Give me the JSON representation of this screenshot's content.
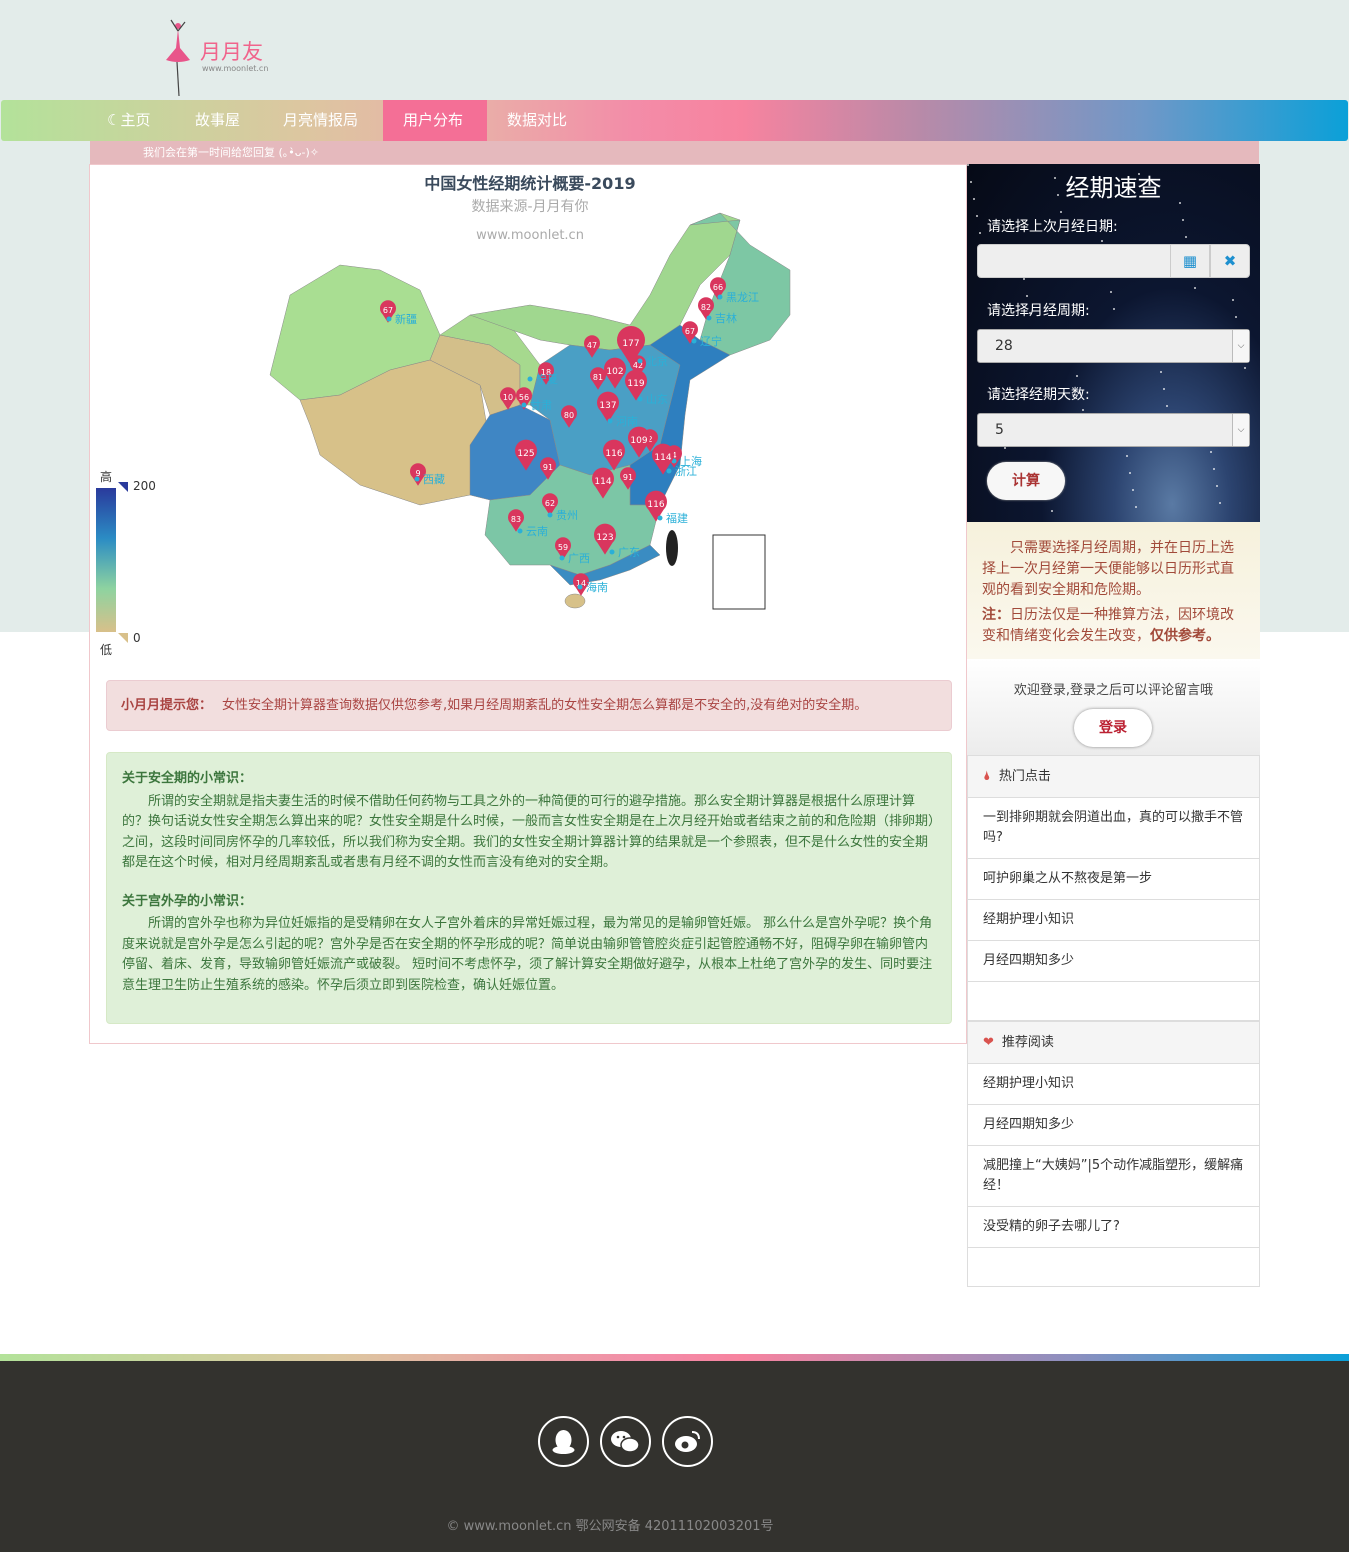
{
  "brand": {
    "name": "月月友",
    "url": "www.moonlet.cn"
  },
  "nav": {
    "items": [
      "主页",
      "故事屋",
      "月亮情报局",
      "用户分布",
      "数据对比"
    ],
    "active": "用户分布"
  },
  "notice": "我们会在第一时间给您回复 (｡•̀ᴗ-)✧",
  "map": {
    "title": "中国女性经期统计概要-2019",
    "subtitle": "数据来源-月月有你",
    "watermark": "www.moonlet.cn",
    "legend": {
      "high": "高",
      "low": "低",
      "max": "200",
      "min": "0"
    },
    "markers": [
      {
        "value": "67",
        "label": "新疆"
      },
      {
        "value": "66",
        "label": ""
      },
      {
        "value": "82",
        "label": "黑龙江"
      },
      {
        "value": "",
        "label": "吉林"
      },
      {
        "value": "67",
        "label": "辽宁"
      },
      {
        "value": "47",
        "label": ""
      },
      {
        "value": "177",
        "label": ""
      },
      {
        "value": "42",
        "label": "北京"
      },
      {
        "value": "18",
        "label": "宁夏"
      },
      {
        "value": "81",
        "label": ""
      },
      {
        "value": "102",
        "label": ""
      },
      {
        "value": "119",
        "label": ""
      },
      {
        "value": "10",
        "label": ""
      },
      {
        "value": "56",
        "label": "甘肃"
      },
      {
        "value": "137",
        "label": "山东"
      },
      {
        "value": "80",
        "label": ""
      },
      {
        "value": "",
        "label": "河南"
      },
      {
        "value": "2",
        "label": ""
      },
      {
        "value": "109",
        "label": ""
      },
      {
        "value": "125",
        "label": ""
      },
      {
        "value": "116",
        "label": ""
      },
      {
        "value": "4",
        "label": "上海"
      },
      {
        "value": "114",
        "label": "浙江"
      },
      {
        "value": "91",
        "label": ""
      },
      {
        "value": "91",
        "label": ""
      },
      {
        "value": "114",
        "label": ""
      },
      {
        "value": "9",
        "label": "西藏"
      },
      {
        "value": "62",
        "label": "贵州"
      },
      {
        "value": "116",
        "label": "福建"
      },
      {
        "value": "83",
        "label": "云南"
      },
      {
        "value": "123",
        "label": ""
      },
      {
        "value": "59",
        "label": "广西"
      },
      {
        "value": "",
        "label": "广东"
      },
      {
        "value": "14",
        "label": "海南"
      }
    ]
  },
  "alert": {
    "lead": "小月月提示您：",
    "text": "女性安全期计算器查询数据仅供您参考,如果月经周期紊乱的女性安全期怎么算都是不安全的,没有绝对的安全期。"
  },
  "tips": [
    {
      "title": "关于安全期的小常识：",
      "body": "所谓的安全期就是指夫妻生活的时候不借助任何药物与工具之外的一种简便的可行的避孕措施。那么安全期计算器是根据什么原理计算的？换句话说女性安全期怎么算出来的呢？女性安全期是什么时候，一般而言女性安全期是在上次月经开始或者结束之前的和危险期（排卵期）之间，这段时间同房怀孕的几率较低，所以我们称为安全期。我们的女性安全期计算器计算的结果就是一个参照表，但不是什么女性的安全期都是在这个时候，相对月经周期紊乱或者患有月经不调的女性而言没有绝对的安全期。"
    },
    {
      "title": "关于宫外孕的小常识：",
      "body": "所谓的宫外孕也称为异位妊娠指的是受精卵在女人子宫外着床的异常妊娠过程，最为常见的是输卵管妊娠。 那么什么是宫外孕呢？换个角度来说就是宫外孕是怎么引起的呢？宫外孕是否在安全期的怀孕形成的呢？简单说由输卵管管腔炎症引起管腔通畅不好，阻碍孕卵在输卵管内停留、着床、发育，导致输卵管妊娠流产或破裂。 短时间不考虑怀孕，须了解计算安全期做好避孕，从根本上杜绝了宫外孕的发生、同时要注意生理卫生防止生殖系统的感染。怀孕后须立即到医院检查，确认妊娠位置。"
    }
  ],
  "calc": {
    "title": "经期速查",
    "date_label": "请选择上次月经日期:",
    "date_value": "",
    "cycle_label": "请选择月经周期:",
    "cycle_value": "28",
    "days_label": "请选择经期天数:",
    "days_value": "5",
    "button": "计算"
  },
  "note": {
    "text": "只需要选择月经周期，并在日历上选择上一次月经第一天便能够以日历形式直观的看到安全期和危险期。",
    "note_lead": "注：",
    "note_text": "日历法仅是一种推算方法，因环境改变和情绪变化会发生改变，",
    "note_bold": "仅供参考。"
  },
  "login": {
    "text": "欢迎登录,登录之后可以评论留言哦",
    "button": "登录"
  },
  "hot": {
    "title": "热门点击",
    "items": [
      "一到排卵期就会阴道出血，真的可以撒手不管吗?",
      "呵护卵巢之从不熬夜是第一步",
      "经期护理小知识",
      "月经四期知多少"
    ]
  },
  "recommend": {
    "title": "推荐阅读",
    "items": [
      "经期护理小知识",
      "月经四期知多少",
      "减肥撞上“大姨妈”|5个动作减脂塑形，缓解痛经！",
      "没受精的卵子去哪儿了?"
    ]
  },
  "footer": {
    "copyright": "© www.moonlet.cn  鄂公网安备 42011102003201号"
  },
  "colors": {
    "accent": "#f46f96",
    "map_high": "#2a3a9c",
    "map_low": "#d8c08a",
    "marker": "#d9365e"
  }
}
